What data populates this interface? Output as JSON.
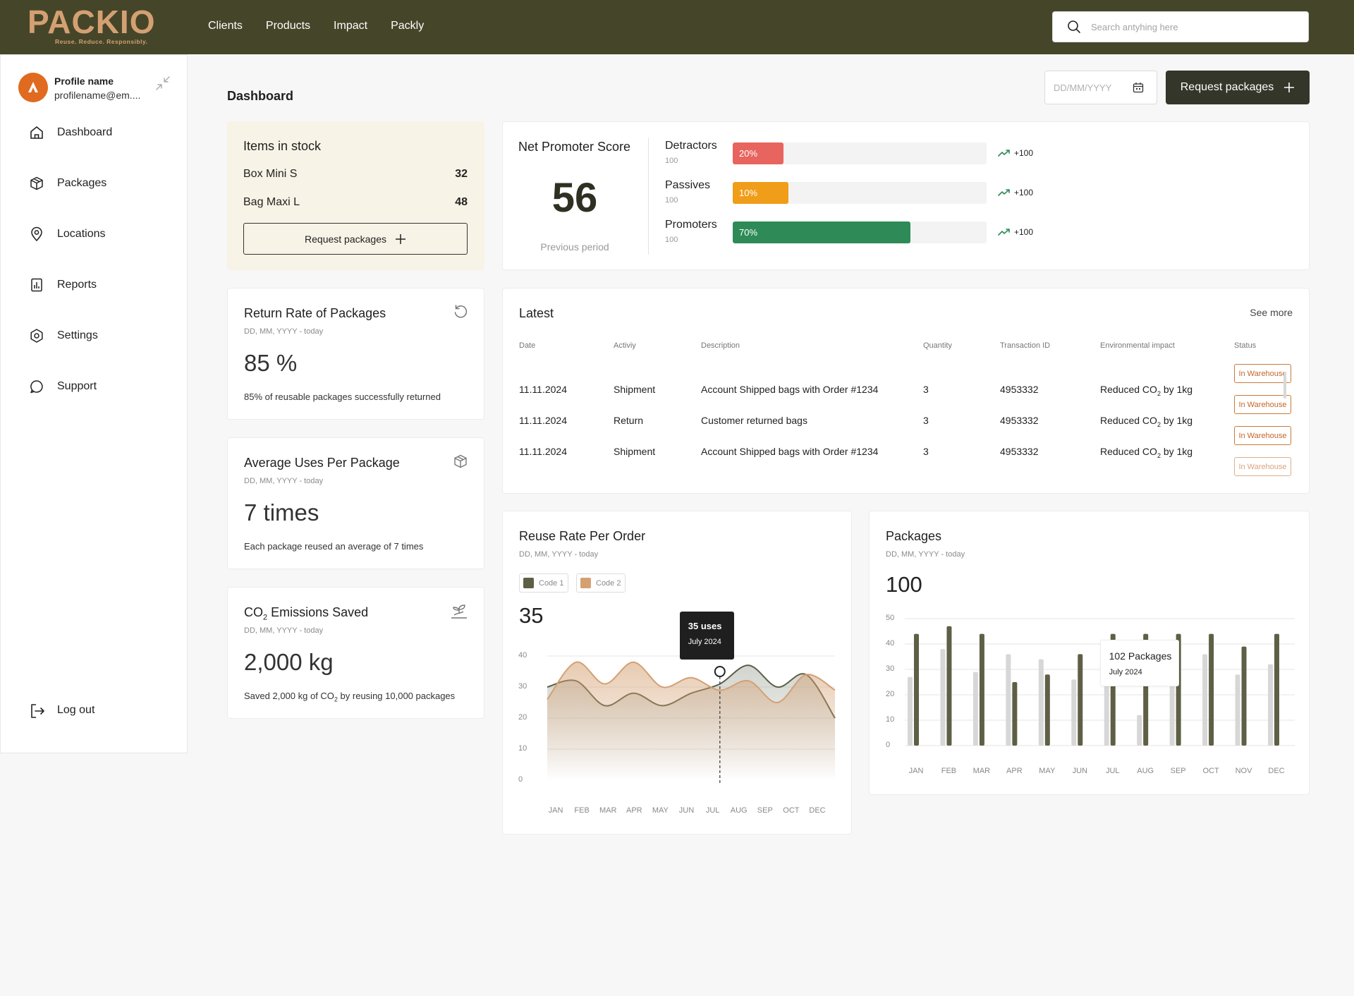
{
  "brand": {
    "name": "PACKIO",
    "tagline": "Reuse. Reduce. Responsibly.",
    "color": "#d4a072"
  },
  "topnav": [
    "Clients",
    "Products",
    "Impact",
    "Packly"
  ],
  "search": {
    "placeholder": "Search antyhing here"
  },
  "profile": {
    "name": "Profile name",
    "email": "profilename@em...."
  },
  "sidebar": {
    "items": [
      {
        "label": "Dashboard",
        "icon": "home-icon"
      },
      {
        "label": "Packages",
        "icon": "box-icon"
      },
      {
        "label": "Locations",
        "icon": "location-pin-icon"
      },
      {
        "label": "Reports",
        "icon": "reports-icon"
      },
      {
        "label": "Settings",
        "icon": "settings-icon"
      },
      {
        "label": "Support",
        "icon": "support-icon"
      }
    ],
    "logout": "Log out"
  },
  "header": {
    "title": "Dashboard",
    "date_placeholder": "DD/MM/YYYY",
    "request_button": "Request packages"
  },
  "stock": {
    "title": "Items in stock",
    "items": [
      {
        "name": "Box Mini S",
        "qty": "32"
      },
      {
        "name": "Bag Maxi L",
        "qty": "48"
      }
    ],
    "button": "Request packages"
  },
  "kpis": [
    {
      "title": "Return Rate of Packages",
      "subtitle": "DD, MM, YYYY - today",
      "value": "85 %",
      "desc": "85% of reusable packages successfully returned",
      "icon": "refresh-icon"
    },
    {
      "title": "Average Uses Per Package",
      "subtitle": "DD, MM, YYYY - today",
      "value": "7 times",
      "desc": "Each package reused an average of 7 times",
      "icon": "package-icon"
    },
    {
      "title_pre": "CO",
      "title_sub": "2",
      "title_post": " Emissions Saved",
      "subtitle": "DD, MM, YYYY - today",
      "value": "2,000 kg",
      "desc_pre": "Saved 2,000 kg of CO",
      "desc_sub": "2",
      "desc_post": " by reusing 10,000 packages",
      "icon": "plant-icon"
    }
  ],
  "nps": {
    "title": "Net Promoter Score",
    "value": "56",
    "previous": "Previous period",
    "rows": [
      {
        "label": "Detractors",
        "max": "100",
        "percent": 20,
        "percent_label": "20%",
        "color": "#e8645e",
        "delta": "+100"
      },
      {
        "label": "Passives",
        "max": "100",
        "percent": 10,
        "percent_label": "10%",
        "color": "#f09d1a",
        "delta": "+100"
      },
      {
        "label": "Promoters",
        "max": "100",
        "percent": 70,
        "percent_label": "70%",
        "color": "#2e8b57",
        "delta": "+100"
      }
    ]
  },
  "latest": {
    "title": "Latest",
    "see_more": "See more",
    "columns": [
      "Date",
      "Activiy",
      "Description",
      "Quantity",
      "Transaction ID",
      "Environmental impact",
      "Status"
    ],
    "rows": [
      {
        "date": "11.11.2024",
        "activity": "Shipment",
        "description": "Account Shipped bags with Order #1234",
        "quantity": "3",
        "txid": "4953332",
        "impact_pre": "Reduced CO",
        "impact_sub": "2",
        "impact_post": " by 1kg"
      },
      {
        "date": "11.11.2024",
        "activity": "Return",
        "description": "Customer returned bags",
        "quantity": "3",
        "txid": "4953332",
        "impact_pre": "Reduced CO",
        "impact_sub": "2",
        "impact_post": " by 1kg"
      },
      {
        "date": "11.11.2024",
        "activity": "Shipment",
        "description": "Account Shipped bags with Order #1234",
        "quantity": "3",
        "txid": "4953332",
        "impact_pre": "Reduced CO",
        "impact_sub": "2",
        "impact_post": " by 1kg"
      }
    ],
    "badges": [
      "In Warehouse",
      "In Warehouse",
      "In Warehouse",
      "In Warehouse"
    ]
  },
  "reuse_tooltip": {
    "line1": "35 uses",
    "line2": "July 2024"
  },
  "packages_tooltip": {
    "line1": "102 Packages",
    "line2": "July 2024"
  },
  "chart_data": [
    {
      "type": "area",
      "title": "Reuse Rate Per Order",
      "subtitle": "DD, MM, YYYY - today",
      "headline": "35",
      "categories": [
        "JAN",
        "FEB",
        "MAR",
        "APR",
        "MAY",
        "JUN",
        "JUL",
        "AUG",
        "SEP",
        "OCT",
        "DEC"
      ],
      "ylim": [
        0,
        40
      ],
      "yticks": [
        0,
        10,
        20,
        30,
        40
      ],
      "series": [
        {
          "name": "Code 1",
          "color": "#5e5f45",
          "values": [
            30,
            32,
            24,
            28,
            24,
            28,
            31,
            37,
            30,
            34,
            20
          ]
        },
        {
          "name": "Code 2",
          "color": "#d4a072",
          "values": [
            26,
            38,
            31,
            38,
            30,
            33,
            29,
            32,
            25,
            34,
            29
          ]
        }
      ],
      "highlight": {
        "category": "JUL",
        "value": 35
      }
    },
    {
      "type": "bar",
      "title": "Packages",
      "subtitle": "DD, MM, YYYY - today",
      "headline": "100",
      "categories": [
        "JAN",
        "FEB",
        "MAR",
        "APR",
        "MAY",
        "JUN",
        "JUL",
        "AUG",
        "SEP",
        "OCT",
        "NOV",
        "DEC"
      ],
      "ylim": [
        0,
        50
      ],
      "yticks": [
        0,
        10,
        20,
        30,
        40,
        50
      ],
      "series": [
        {
          "color": "#d7d7d7",
          "values": [
            27,
            38,
            29,
            36,
            34,
            26,
            25,
            12,
            26,
            36,
            28,
            32
          ]
        },
        {
          "color": "#5e5f45",
          "values": [
            44,
            47,
            44,
            25,
            28,
            36,
            44,
            44,
            44,
            44,
            39,
            44
          ]
        }
      ],
      "highlight": {
        "category": "SEP"
      }
    }
  ]
}
